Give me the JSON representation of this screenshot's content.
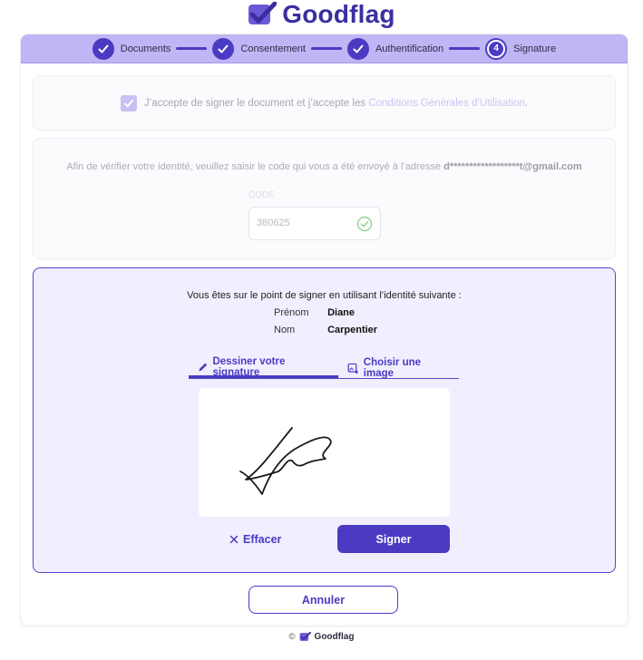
{
  "brand": {
    "name": "Goodflag",
    "colors": {
      "primary": "#4a3bc2",
      "stepper_bg": "#c0b5f5",
      "panel_bg": "#f1efff",
      "success": "#8fd18f"
    }
  },
  "stepper": {
    "steps": [
      {
        "label": "Documents",
        "state": "done"
      },
      {
        "label": "Consentement",
        "state": "done"
      },
      {
        "label": "Authentification",
        "state": "done"
      },
      {
        "label": "Signature",
        "state": "current",
        "number": "4"
      }
    ]
  },
  "consent": {
    "text": "J’accepte de signer le document et j’accepte les",
    "link": "Conditions Générales d’Utilisation",
    "suffix": "."
  },
  "verification": {
    "text": "Afin de vérifier votre identité, veuillez saisir le code qui vous a été envoyé à l’adresse",
    "email": "d******************t@gmail.com",
    "code_label": "CODE",
    "code_value": "380625"
  },
  "signature": {
    "intro": "Vous êtes sur le point de signer en utilisant l’identité suivante :",
    "first_name_label": "Prénom",
    "first_name": "Diane",
    "last_name_label": "Nom",
    "last_name": "Carpentier",
    "tabs": [
      {
        "label": "Dessiner votre signature",
        "icon": "pencil-icon",
        "active": true
      },
      {
        "label": "Choisir une image",
        "icon": "image-upload-icon",
        "active": false
      }
    ],
    "clear_label": "Effacer",
    "sign_label": "Signer"
  },
  "cancel_label": "Annuler",
  "footer": {
    "copyright": "©",
    "brand": "Goodflag"
  }
}
